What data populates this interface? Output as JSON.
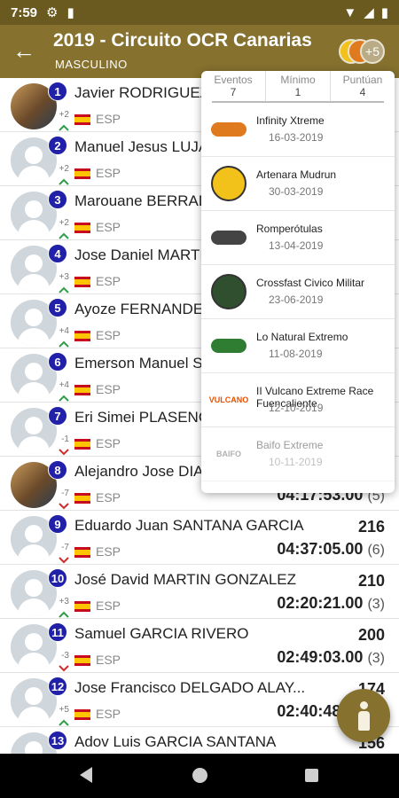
{
  "status_bar": {
    "time": "7:59"
  },
  "app_bar": {
    "title": "2019 - Circuito OCR Canarias",
    "subtitle": "MASCULINO",
    "more_chip": "+5"
  },
  "ranking": [
    {
      "rank": "1",
      "name": "Javier RODRIGUEZ D",
      "change": "+2",
      "trend": "up",
      "country": "ESP",
      "points": "",
      "time": "",
      "count": "",
      "photo": true
    },
    {
      "rank": "2",
      "name": "Manuel Jesus LUJAN",
      "change": "+2",
      "trend": "up",
      "country": "ESP",
      "points": "",
      "time": "",
      "count": "",
      "photo": false
    },
    {
      "rank": "3",
      "name": "Marouane BERRADI",
      "change": "+2",
      "trend": "up",
      "country": "ESP",
      "points": "",
      "time": "",
      "count": "",
      "photo": false
    },
    {
      "rank": "4",
      "name": "Jose Daniel MARTIN",
      "change": "+3",
      "trend": "up",
      "country": "ESP",
      "points": "",
      "time": "",
      "count": "",
      "photo": false
    },
    {
      "rank": "5",
      "name": "Ayoze FERNANDEZ A",
      "change": "+4",
      "trend": "up",
      "country": "ESP",
      "points": "",
      "time": "",
      "count": "",
      "photo": false
    },
    {
      "rank": "6",
      "name": "Emerson Manuel SO",
      "change": "+4",
      "trend": "up",
      "country": "ESP",
      "points": "",
      "time": "",
      "count": "",
      "photo": false
    },
    {
      "rank": "7",
      "name": "Eri Simei PLASENCIA",
      "change": "-1",
      "trend": "down",
      "country": "ESP",
      "points": "",
      "time": "",
      "count": "",
      "photo": false
    },
    {
      "rank": "8",
      "name": "Alejandro Jose DIAZ",
      "change": "-7",
      "trend": "down",
      "country": "ESP",
      "points": "",
      "time": "04:17:53.00",
      "count": "(5)",
      "photo": true
    },
    {
      "rank": "9",
      "name": "Eduardo Juan SANTANA GARCIA",
      "change": "-7",
      "trend": "down",
      "country": "ESP",
      "points": "216",
      "time": "04:37:05.00",
      "count": "(6)",
      "photo": false
    },
    {
      "rank": "10",
      "name": "José David MARTIN GONZALEZ",
      "change": "+3",
      "trend": "up",
      "country": "ESP",
      "points": "210",
      "time": "02:20:21.00",
      "count": "(3)",
      "photo": false
    },
    {
      "rank": "11",
      "name": "Samuel GARCIA RIVERO",
      "change": "-3",
      "trend": "down",
      "country": "ESP",
      "points": "200",
      "time": "02:49:03.00",
      "count": "(3)",
      "photo": false
    },
    {
      "rank": "12",
      "name": "Jose Francisco DELGADO ALAY...",
      "change": "+5",
      "trend": "up",
      "country": "ESP",
      "points": "174",
      "time": "02:40:48.00",
      "count": "(3)",
      "photo": false
    },
    {
      "rank": "13",
      "name": "Adov Luis GARCIA SANTANA",
      "change": "",
      "trend": "up",
      "country": "ESP",
      "points": "156",
      "time": "",
      "count": "",
      "photo": false
    }
  ],
  "popup": {
    "headers": [
      {
        "label": "Eventos",
        "value": "7"
      },
      {
        "label": "Mínimo",
        "value": "1"
      },
      {
        "label": "Puntúan",
        "value": "4"
      }
    ],
    "events": [
      {
        "name": "Infinity Xtreme",
        "date": "16-03-2019",
        "logo_text": "",
        "logo_color": "#e07a1f"
      },
      {
        "name": "Artenara Mudrun",
        "date": "30-03-2019",
        "logo_text": "",
        "logo_color": "#f2c21b"
      },
      {
        "name": "Romperótulas",
        "date": "13-04-2019",
        "logo_text": "",
        "logo_color": "#444444"
      },
      {
        "name": "Crossfast Civico Militar",
        "date": "23-06-2019",
        "logo_text": "",
        "logo_color": "#2f4f2f"
      },
      {
        "name": "Lo Natural Extremo",
        "date": "11-08-2019",
        "logo_text": "",
        "logo_color": "#2e7d32"
      },
      {
        "name": "II Vulcano Extreme Race Fuencaliente",
        "date": "12-10-2019",
        "logo_text": "VULCANO",
        "logo_color": "#e65100"
      },
      {
        "name": "Baifo Extreme",
        "date": "10-11-2019",
        "logo_text": "BAIFO",
        "logo_color": "#555555"
      }
    ]
  },
  "colors": {
    "app_bar": "#86712e",
    "rank_badge": "#2020a8",
    "trend_up": "#2e9e4a",
    "trend_down": "#d02b2b"
  }
}
